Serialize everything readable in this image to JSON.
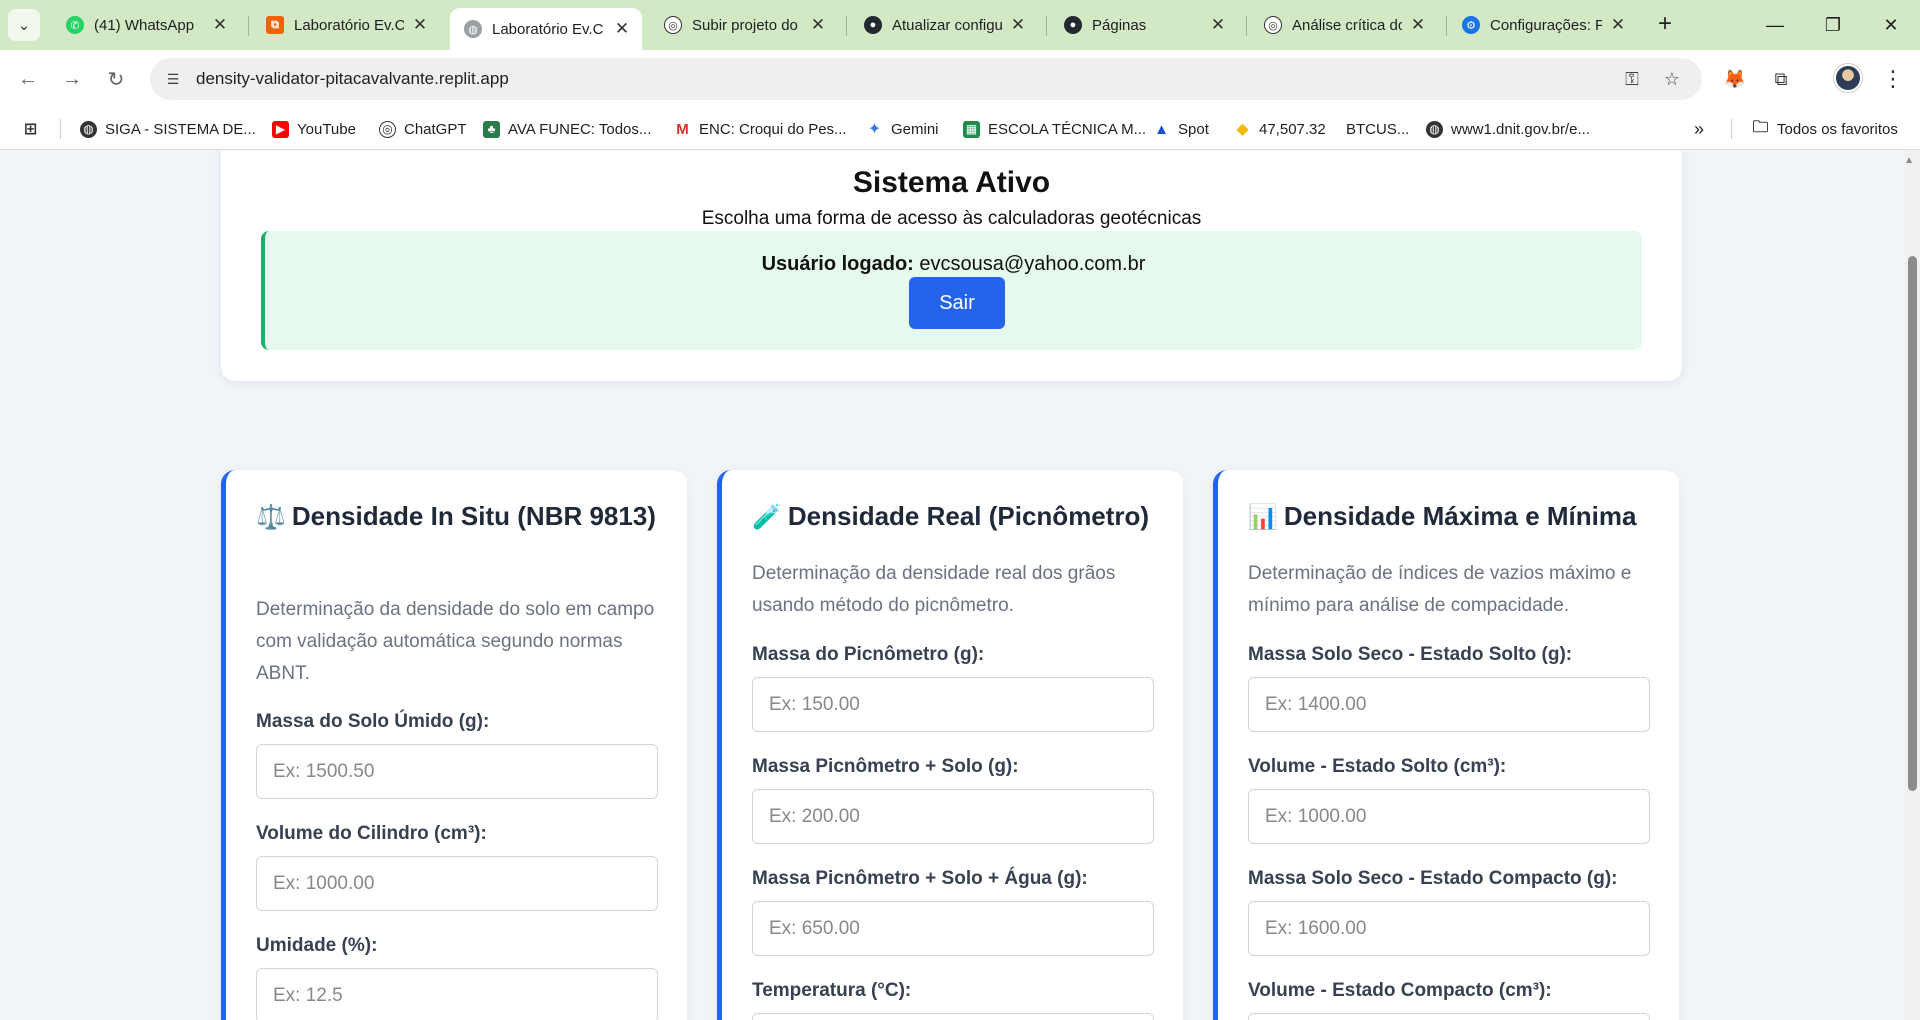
{
  "browser": {
    "tabs": [
      {
        "label": "(41) WhatsApp",
        "icon": "whatsapp-icon",
        "color": "#25d366"
      },
      {
        "label": "Laboratório Ev.C",
        "icon": "replit-icon",
        "color": "#f26207"
      },
      {
        "label": "Laboratório Ev.C",
        "icon": "globe-icon",
        "color": "#888888",
        "active": true
      },
      {
        "label": "Subir projeto do",
        "icon": "openai-icon",
        "color": "#333333"
      },
      {
        "label": "Atualizar configu",
        "icon": "github-icon",
        "color": "#24292f"
      },
      {
        "label": "Páginas",
        "icon": "github-icon",
        "color": "#24292f"
      },
      {
        "label": "Análise crítica do",
        "icon": "openai-icon",
        "color": "#333333"
      },
      {
        "label": "Configurações: P",
        "icon": "settings-icon",
        "color": "#1a73e8"
      }
    ],
    "url": "density-validator-pitacavalvante.replit.app",
    "bookmarks": [
      {
        "label": "SIGA - SISTEMA DE...",
        "icon": "globe-icon"
      },
      {
        "label": "YouTube",
        "icon": "youtube-icon"
      },
      {
        "label": "ChatGPT",
        "icon": "openai-icon"
      },
      {
        "label": "AVA FUNEC: Todos...",
        "icon": "ava-icon"
      },
      {
        "label": "ENC: Croqui do Pes...",
        "icon": "gmail-icon"
      },
      {
        "label": "Gemini",
        "icon": "gemini-icon"
      },
      {
        "label": "ESCOLA TÉCNICA M...",
        "icon": "school-icon"
      },
      {
        "label": "Spot",
        "icon": "spot-icon"
      },
      {
        "label": "47,507.32",
        "icon": "binance-icon"
      },
      {
        "label": "BTCUS...",
        "icon": "none"
      },
      {
        "label": "www1.dnit.gov.br/e...",
        "icon": "globe-icon"
      }
    ],
    "all_bookmarks": "Todos os favoritos"
  },
  "status": {
    "title": "Sistema Ativo",
    "subtitle": "Escolha uma forma de acesso às calculadoras geotécnicas",
    "user_label": "Usuário logado:",
    "user_email": "evcsousa@yahoo.com.br",
    "logout_button": "Sair"
  },
  "cards": [
    {
      "emoji": "⚖️",
      "title": "Densidade In Situ (NBR 9813)",
      "description": "Determinação da densidade do solo em campo com validação automática segundo normas ABNT.",
      "fields": [
        {
          "label": "Massa do Solo Úmido (g):",
          "placeholder": "Ex: 1500.50"
        },
        {
          "label": "Volume do Cilindro (cm³):",
          "placeholder": "Ex: 1000.00"
        },
        {
          "label": "Umidade (%):",
          "placeholder": "Ex: 12.5"
        }
      ]
    },
    {
      "emoji": "🧪",
      "title": "Densidade Real (Picnômetro)",
      "description": "Determinação da densidade real dos grãos usando método do picnômetro.",
      "fields": [
        {
          "label": "Massa do Picnômetro (g):",
          "placeholder": "Ex: 150.00"
        },
        {
          "label": "Massa Picnômetro + Solo (g):",
          "placeholder": "Ex: 200.00"
        },
        {
          "label": "Massa Picnômetro + Solo + Água (g):",
          "placeholder": "Ex: 650.00"
        },
        {
          "label": "Temperatura (°C):",
          "placeholder": ""
        }
      ]
    },
    {
      "emoji": "📊",
      "title": "Densidade Máxima e Mínima",
      "description": "Determinação de índices de vazios máximo e mínimo para análise de compacidade.",
      "fields": [
        {
          "label": "Massa Solo Seco - Estado Solto (g):",
          "placeholder": "Ex: 1400.00"
        },
        {
          "label": "Volume - Estado Solto (cm³):",
          "placeholder": "Ex: 1000.00"
        },
        {
          "label": "Massa Solo Seco - Estado Compacto (g):",
          "placeholder": "Ex: 1600.00"
        },
        {
          "label": "Volume - Estado Compacto (cm³):",
          "placeholder": ""
        }
      ]
    }
  ],
  "colors": {
    "accent": "#2563eb",
    "success_border": "#1fae6b",
    "success_bg": "#e6f9ee",
    "tabstrip": "#d3e9c6"
  }
}
